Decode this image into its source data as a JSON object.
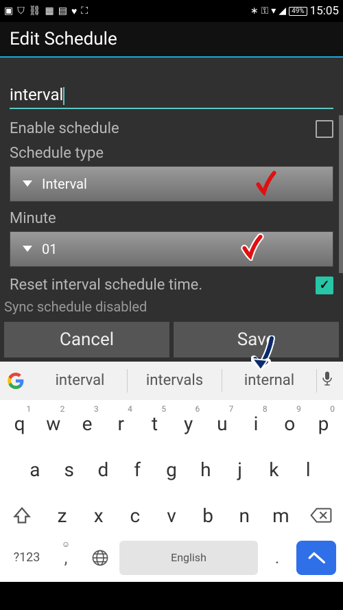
{
  "status_bar": {
    "battery_pct": "49%",
    "time": "15:05"
  },
  "header": {
    "title": "Edit Schedule"
  },
  "form": {
    "name_value": "interval",
    "enable_label": "Enable schedule",
    "enable_checked": false,
    "type_label": "Schedule type",
    "type_value": "Interval",
    "minute_label": "Minute",
    "minute_value": "01",
    "reset_label": "Reset interval schedule time.",
    "reset_checked": true,
    "status_text": "Sync schedule disabled",
    "cancel_label": "Cancel",
    "save_label": "Save"
  },
  "keyboard": {
    "suggestions": [
      "interval",
      "intervals",
      "internal"
    ],
    "row1": [
      {
        "k": "q",
        "n": "1"
      },
      {
        "k": "w",
        "n": "2"
      },
      {
        "k": "e",
        "n": "3"
      },
      {
        "k": "r",
        "n": "4"
      },
      {
        "k": "t",
        "n": "5"
      },
      {
        "k": "y",
        "n": "6"
      },
      {
        "k": "u",
        "n": "7"
      },
      {
        "k": "i",
        "n": "8"
      },
      {
        "k": "o",
        "n": "9"
      },
      {
        "k": "p",
        "n": "0"
      }
    ],
    "row2": [
      "a",
      "s",
      "d",
      "f",
      "g",
      "h",
      "j",
      "k",
      "l"
    ],
    "row3": [
      "z",
      "x",
      "c",
      "v",
      "b",
      "n",
      "m"
    ],
    "sym_label": "?123",
    "space_label": "English"
  }
}
